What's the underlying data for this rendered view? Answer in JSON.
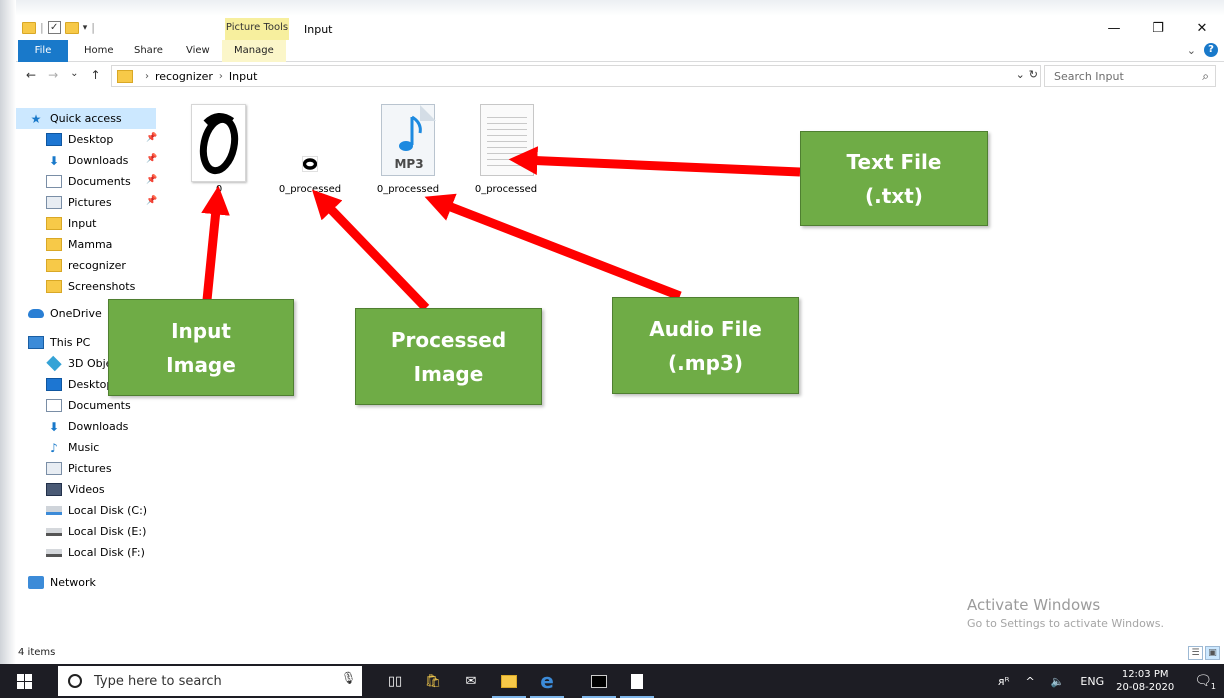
{
  "window": {
    "title": "Input",
    "context_tab": "Picture Tools",
    "controls": {
      "minimize": "—",
      "restore": "❐",
      "close": "✕"
    }
  },
  "ribbon": {
    "tabs": [
      {
        "label": "File"
      },
      {
        "label": "Home"
      },
      {
        "label": "Share"
      },
      {
        "label": "View"
      },
      {
        "label": "Manage"
      }
    ],
    "chevron": "⌄",
    "help": "?"
  },
  "address": {
    "nav": {
      "back": "←",
      "forward": "→",
      "recent": "⌄",
      "up": "↑"
    },
    "crumbs": [
      "recognizer",
      "Input"
    ],
    "separator": "›",
    "dropdown": "⌄",
    "refresh": "↻",
    "search_placeholder": "Search Input",
    "search_icon": "⌕"
  },
  "sidebar": {
    "quick_access": "Quick access",
    "quick_items": [
      {
        "label": "Desktop",
        "icon": "desktop-icon",
        "pinned": true
      },
      {
        "label": "Downloads",
        "icon": "download-icon",
        "pinned": true
      },
      {
        "label": "Documents",
        "icon": "documents-icon",
        "pinned": true
      },
      {
        "label": "Pictures",
        "icon": "pictures-icon",
        "pinned": true
      },
      {
        "label": "Input",
        "icon": "folder-icon",
        "pinned": false
      },
      {
        "label": "Mamma",
        "icon": "folder-icon",
        "pinned": false
      },
      {
        "label": "recognizer",
        "icon": "folder-icon",
        "pinned": false
      },
      {
        "label": "Screenshots",
        "icon": "folder-icon",
        "pinned": false
      }
    ],
    "pin_glyph": "📌",
    "onedrive": "OneDrive",
    "this_pc": "This PC",
    "pc_items": [
      {
        "label": "3D Objects",
        "icon": "3d-objects-icon"
      },
      {
        "label": "Desktop",
        "icon": "desktop-icon"
      },
      {
        "label": "Documents",
        "icon": "documents-icon"
      },
      {
        "label": "Downloads",
        "icon": "download-icon"
      },
      {
        "label": "Music",
        "icon": "music-icon"
      },
      {
        "label": "Pictures",
        "icon": "pictures-icon"
      },
      {
        "label": "Videos",
        "icon": "videos-icon"
      },
      {
        "label": "Local Disk (C:)",
        "icon": "disk-c-icon"
      },
      {
        "label": "Local Disk (E:)",
        "icon": "disk-icon"
      },
      {
        "label": "Local Disk (F:)",
        "icon": "disk-icon"
      }
    ],
    "network": "Network"
  },
  "files": [
    {
      "name": "0",
      "type": "image"
    },
    {
      "name": "0_processed",
      "type": "image"
    },
    {
      "name": "0_processed",
      "type": "mp3"
    },
    {
      "name": "0_processed",
      "type": "txt"
    }
  ],
  "file_glyphs": {
    "input_digit": "O",
    "mp3_note": "♪",
    "mp3_label": "MP3"
  },
  "callouts": {
    "input": "Input\nImage",
    "processed": "Processed\nImage",
    "audio": "Audio File\n(.mp3)",
    "text": "Text File\n(.txt)"
  },
  "watermark": {
    "line1": "Activate Windows",
    "line2": "Go to Settings to activate Windows."
  },
  "status": {
    "count": "4 items"
  },
  "taskbar": {
    "search_placeholder": "Type here to search",
    "tray_people": "ᴙᴿ",
    "tray_up": "^",
    "tray_volume": "🔈",
    "tray_lang": "ENG",
    "time": "12:03 PM",
    "date": "20-08-2020",
    "notification_count": "1"
  },
  "colors": {
    "accent": "#1979ca",
    "callout": "#6fac46",
    "arrow": "#ff0000",
    "taskbar": "#1d1d24"
  }
}
